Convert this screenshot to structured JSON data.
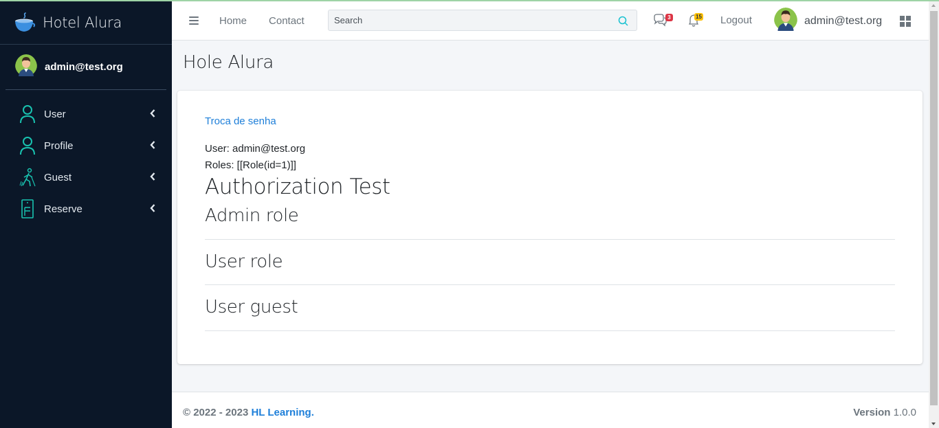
{
  "brand": {
    "name": "Hotel Alura"
  },
  "sidebar": {
    "user_name": "admin@test.org",
    "items": [
      {
        "label": "User",
        "icon": "person-outline-icon"
      },
      {
        "label": "Profile",
        "icon": "person-outline-icon"
      },
      {
        "label": "Guest",
        "icon": "guest-walking-icon"
      },
      {
        "label": "Reserve",
        "icon": "reserve-door-icon"
      }
    ]
  },
  "header": {
    "home_label": "Home",
    "contact_label": "Contact",
    "search_placeholder": "Search",
    "messages_badge": "3",
    "notifications_badge": "15",
    "logout_label": "Logout",
    "user_name": "admin@test.org"
  },
  "content": {
    "page_title": "Hole Alura",
    "change_password_link": "Troca de senha",
    "user_line": "User: admin@test.org",
    "roles_line": "Roles: [[Role(id=1)]]",
    "auth_heading": "Authorization Test",
    "sections": [
      "Admin role",
      "User role",
      "User guest"
    ]
  },
  "footer": {
    "copyright": "© 2022 - 2023 ",
    "company": "HL Learning.",
    "version_label": "Version",
    "version_number": "1.0.0"
  },
  "colors": {
    "sidebar_bg": "#0b1728",
    "accent_teal": "#19c3b0",
    "link_blue": "#1e7fd9",
    "badge_red": "#dc3545",
    "badge_yellow": "#ffc107"
  }
}
